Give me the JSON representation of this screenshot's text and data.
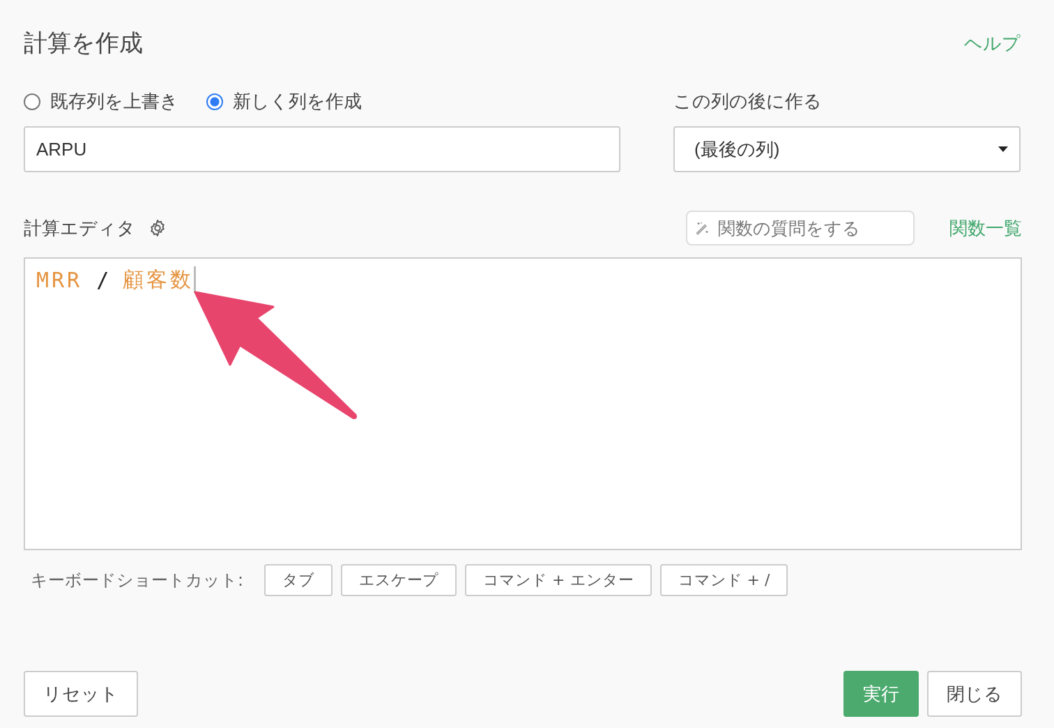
{
  "dialog": {
    "title": "計算を作成",
    "help_link": "ヘルプ"
  },
  "mode_options": [
    {
      "label": "既存列を上書き",
      "selected": false
    },
    {
      "label": "新しく列を作成",
      "selected": true
    }
  ],
  "column_name": {
    "value": "ARPU"
  },
  "insert_after": {
    "label": "この列の後に作る",
    "value": "(最後の列)"
  },
  "editor": {
    "label": "計算エディタ",
    "ask_field": {
      "placeholder": "関数の質問をする"
    },
    "function_list_link": "関数一覧",
    "tokens": [
      {
        "text": "MRR",
        "kind": "column"
      },
      {
        "text": "/",
        "kind": "operator"
      },
      {
        "text": "顧客数",
        "kind": "column"
      }
    ]
  },
  "shortcuts": {
    "label": "キーボードショートカット:",
    "keys": [
      "タブ",
      "エスケープ",
      "コマンド + エンター",
      "コマンド + /"
    ]
  },
  "buttons": {
    "reset": "リセット",
    "run": "実行",
    "close": "閉じる"
  }
}
